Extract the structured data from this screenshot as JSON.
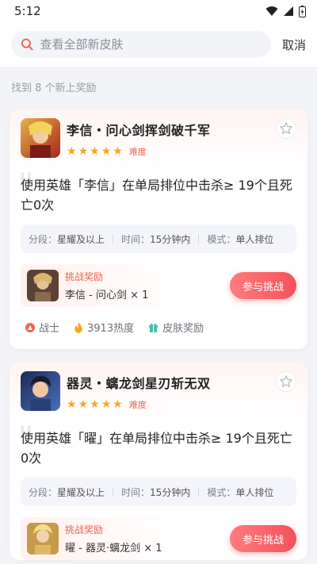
{
  "status": {
    "time": "5:12"
  },
  "search": {
    "placeholder": "查看全部新皮肤",
    "cancel_label": "取消"
  },
  "result_count": "找到 8 个新上奖励",
  "cards": [
    {
      "title": "李信・问心剑挥剑破千军",
      "stars": 5,
      "difficulty_label": "难度",
      "description": "使用英雄「李信」在单局排位中击杀≥ 19个且死亡0次",
      "conditions": {
        "rank_label": "分段：",
        "rank": "星耀及以上",
        "time_label": "时间：",
        "time": "15分钟内",
        "mode_label": "模式：",
        "mode": "单人排位"
      },
      "reward_label": "挑战奖励",
      "reward_item": "李信 - 问心剑 × 1",
      "join_label": "参与挑战",
      "tags": {
        "role": "战士",
        "heat": "3913热度",
        "reward_type": "皮肤奖励"
      },
      "colors": {
        "avatar": "#c9472f",
        "thumb": "#6b4a3a"
      }
    },
    {
      "title": "器灵・螭龙剑星刃斩无双",
      "stars": 5,
      "difficulty_label": "难度",
      "description": "使用英雄「曜」在单局排位中击杀≥ 19个且死亡0次",
      "conditions": {
        "rank_label": "分段：",
        "rank": "星耀及以上",
        "time_label": "时间：",
        "time": "15分钟内",
        "mode_label": "模式：",
        "mode": "单人排位"
      },
      "reward_label": "挑战奖励",
      "reward_item": "曜 - 器灵·螭龙剑 × 1",
      "join_label": "参与挑战",
      "colors": {
        "avatar": "#2e4a8c",
        "thumb": "#c79a4a"
      }
    }
  ],
  "accent": "#f5525a"
}
